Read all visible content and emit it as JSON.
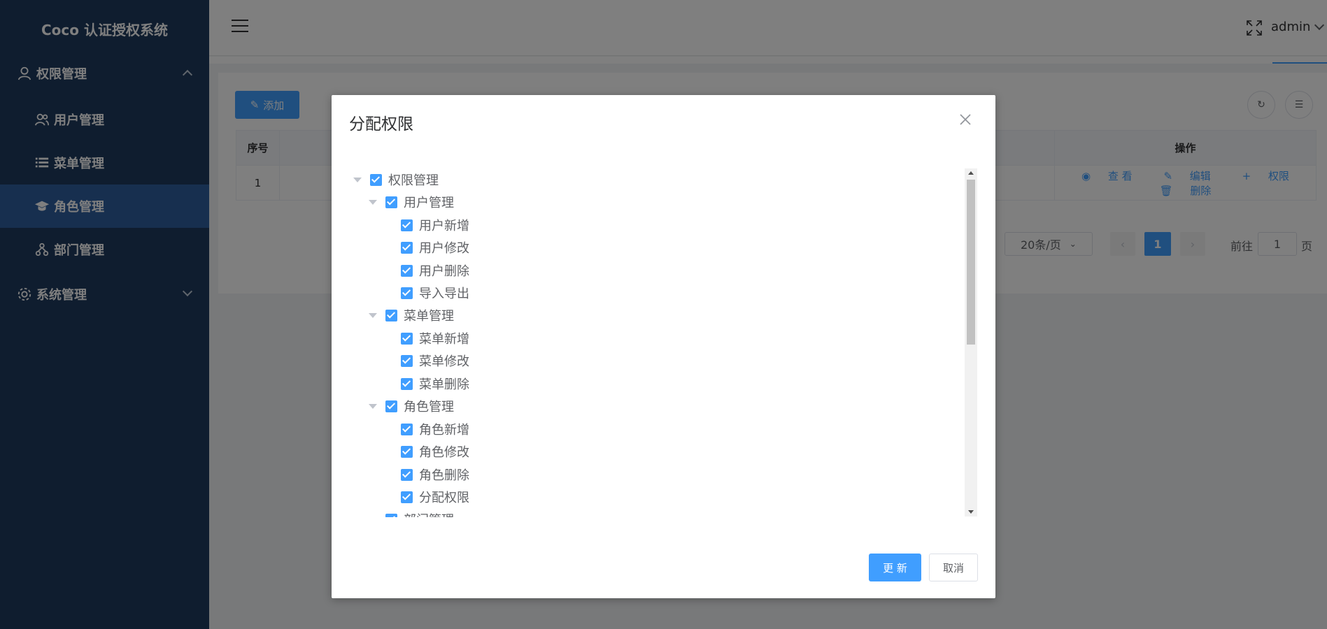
{
  "sidebar": {
    "logo": "Coco 认证授权系统",
    "groups": [
      {
        "label": "权限管理",
        "icon": "user-icon",
        "expanded": true,
        "items": [
          {
            "label": "用户管理",
            "icon": "users-icon"
          },
          {
            "label": "菜单管理",
            "icon": "list-icon"
          },
          {
            "label": "角色管理",
            "icon": "graduation-cap-icon",
            "active": true
          },
          {
            "label": "部门管理",
            "icon": "org-chart-icon"
          }
        ]
      },
      {
        "label": "系统管理",
        "icon": "gear-icon",
        "expanded": false
      }
    ]
  },
  "header": {
    "user": "admin"
  },
  "toolbar": {
    "add_label": "添加"
  },
  "table": {
    "headers": [
      "序号",
      "操作"
    ],
    "rows": [
      {
        "index": "1",
        "actions": [
          "查 看",
          "编辑",
          "权限",
          "删除"
        ]
      }
    ]
  },
  "pagination": {
    "page_size": "20条/页",
    "current_page": "1",
    "goto_label": "前往",
    "goto_value": "1",
    "page_label": "页"
  },
  "dialog": {
    "title": "分配权限",
    "tree": [
      {
        "label": "权限管理",
        "level": 0,
        "expandable": true
      },
      {
        "label": "用户管理",
        "level": 1,
        "expandable": true
      },
      {
        "label": "用户新增",
        "level": 2
      },
      {
        "label": "用户修改",
        "level": 2
      },
      {
        "label": "用户删除",
        "level": 2
      },
      {
        "label": "导入导出",
        "level": 2
      },
      {
        "label": "菜单管理",
        "level": 1,
        "expandable": true
      },
      {
        "label": "菜单新增",
        "level": 2
      },
      {
        "label": "菜单修改",
        "level": 2
      },
      {
        "label": "菜单删除",
        "level": 2
      },
      {
        "label": "角色管理",
        "level": 1,
        "expandable": true
      },
      {
        "label": "角色新增",
        "level": 2
      },
      {
        "label": "角色修改",
        "level": 2
      },
      {
        "label": "角色删除",
        "level": 2
      },
      {
        "label": "分配权限",
        "level": 2
      },
      {
        "label": "部门管理",
        "level": 1,
        "expandable": true
      }
    ],
    "update_label": "更 新",
    "cancel_label": "取消"
  },
  "colors": {
    "primary": "#409eff",
    "sidebar_bg": "#1f3a5e",
    "sidebar_active": "#2f5f9e"
  }
}
